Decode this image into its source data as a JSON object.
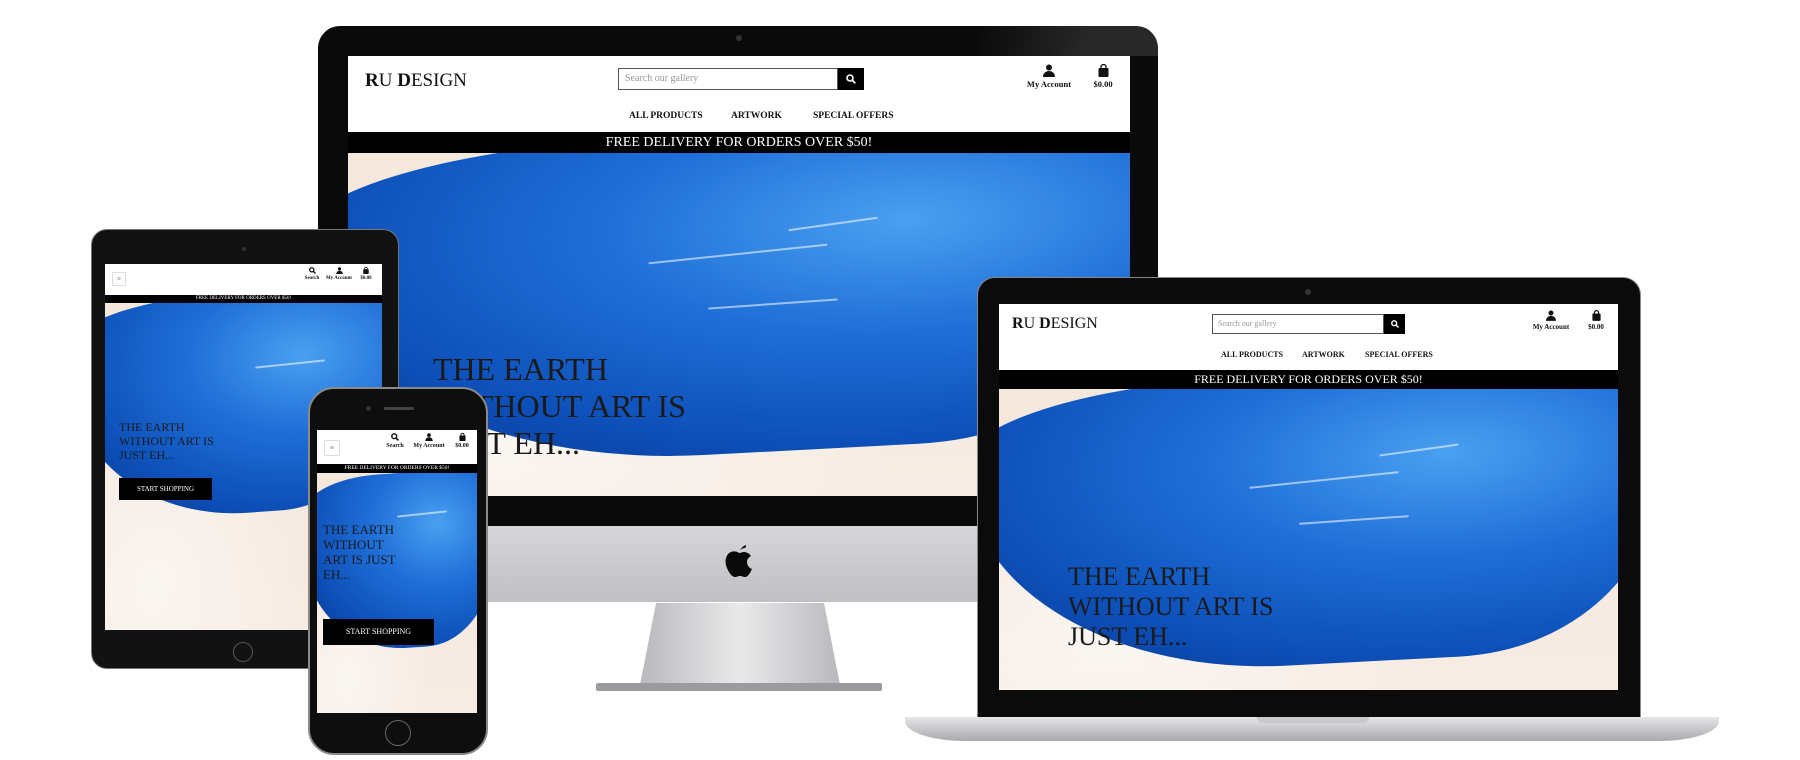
{
  "site": {
    "logo_r": "R",
    "logo_u": "U ",
    "logo_d": "D",
    "logo_esign": "ESIGN",
    "search_placeholder": "Search our gallery",
    "nav": [
      "ALL PRODUCTS",
      "ARTWORK",
      "SPECIAL OFFERS"
    ],
    "account_label": "My Account",
    "cart_total": "$0.00",
    "search_label": "Search",
    "banner": "FREE DELIVERY FOR ORDERS OVER $50!",
    "hero_title": "THE EARTH WITHOUT ART IS JUST EH...",
    "cta": "START SHOPPING",
    "hero_title_lines_desktop": "THE EARTH\nWITHOUT ART IS\nJUST EH...",
    "hero_title_lines_laptop": "THE EARTH\nWITHOUT ART IS\nJUST EH...",
    "hero_title_lines_tablet": "THE EARTH\nWITHOUT ART IS\nJUST EH...",
    "hero_title_lines_phone": "THE EARTH\nWITHOUT\nART IS JUST\nEH..."
  },
  "colors": {
    "paint_blue": "#1f6fd8",
    "banner_bg": "#000000",
    "device_frame": "#111111",
    "aluminium": "#c9cacd"
  },
  "icons": {
    "search": "magnifier-icon",
    "account": "user-icon",
    "cart": "bag-icon",
    "menu": "hamburger-icon",
    "brand": "apple-logo-icon"
  }
}
